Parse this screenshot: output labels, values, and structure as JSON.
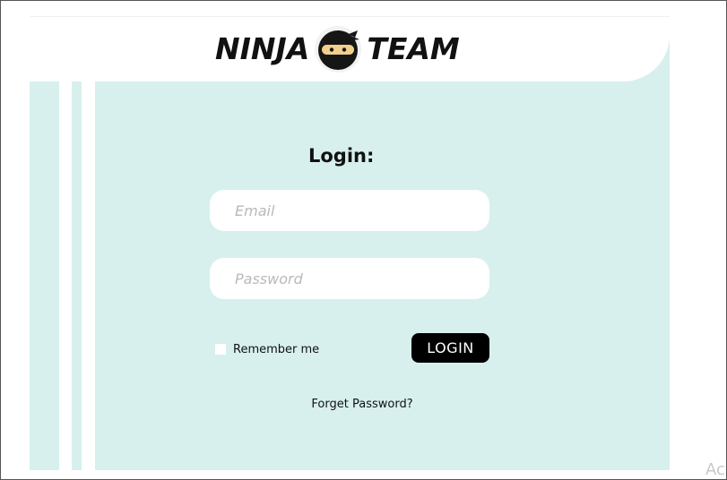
{
  "brand": {
    "left_word": "NINJA",
    "right_word": "TEAM",
    "icon": "ninja-face-icon"
  },
  "form": {
    "title": "Login:",
    "email_placeholder": "Email",
    "password_placeholder": "Password",
    "remember_label": "Remember me",
    "login_label": "LOGIN",
    "forgot_label": "Forget Password?"
  },
  "overlay": {
    "corner_text": "Ac"
  },
  "colors": {
    "panel": "#d7f0ee",
    "button": "#000000",
    "field": "#ffffff"
  }
}
